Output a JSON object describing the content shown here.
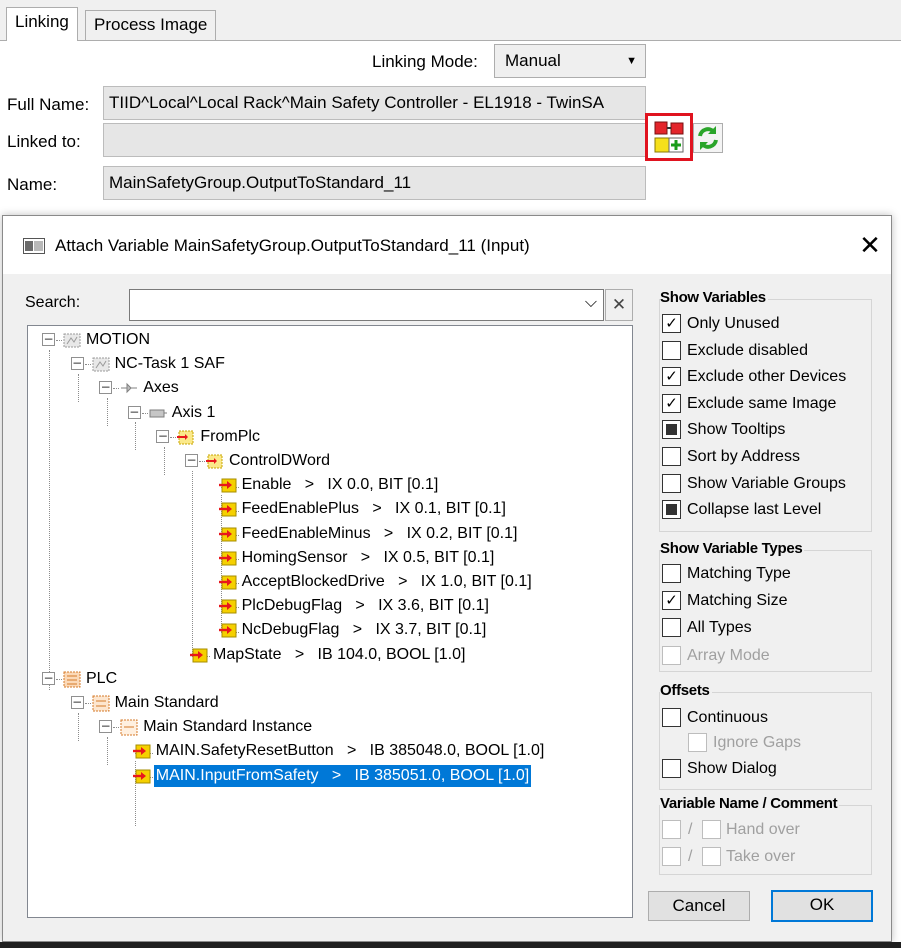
{
  "tabs": [
    {
      "label": "Linking",
      "active": true
    },
    {
      "label": "Process Image",
      "active": false
    }
  ],
  "properties": {
    "linking_mode_label": "Linking Mode:",
    "linking_mode_value": "Manual",
    "full_name_label": "Full Name:",
    "full_name_value": "TIID^Local^Local Rack^Main Safety Controller - EL1918 - TwinSA",
    "linked_to_label": "Linked to:",
    "linked_to_value": "",
    "name_label": "Name:",
    "name_value": "MainSafetyGroup.OutputToStandard_11"
  },
  "dialog": {
    "title": "Attach Variable MainSafetyGroup.OutputToStandard_11 (Input)",
    "close_glyph": "✕",
    "search_label": "Search:",
    "search_value": "",
    "search_clear_glyph": "✕",
    "tree": [
      {
        "label": "MOTION",
        "level": 0,
        "icon": "motion-icon",
        "expanded": true
      },
      {
        "label": "NC-Task 1 SAF",
        "level": 1,
        "icon": "nc-task-icon",
        "expanded": true
      },
      {
        "label": "Axes",
        "level": 2,
        "icon": "axes-icon",
        "expanded": true
      },
      {
        "label": "Axis 1",
        "level": 3,
        "icon": "axis-icon",
        "expanded": true
      },
      {
        "label": "FromPlc",
        "level": 4,
        "icon": "input-folder-icon",
        "expanded": true
      },
      {
        "label": "ControlDWord",
        "level": 5,
        "icon": "input-folder-icon",
        "expanded": true
      },
      {
        "label": "Enable   >   IX 0.0, BIT [0.1]",
        "level": 6,
        "icon": "input-variable-icon"
      },
      {
        "label": "FeedEnablePlus   >   IX 0.1, BIT [0.1]",
        "level": 6,
        "icon": "input-variable-icon"
      },
      {
        "label": "FeedEnableMinus   >   IX 0.2, BIT [0.1]",
        "level": 6,
        "icon": "input-variable-icon"
      },
      {
        "label": "HomingSensor   >   IX 0.5, BIT [0.1]",
        "level": 6,
        "icon": "input-variable-icon"
      },
      {
        "label": "AcceptBlockedDrive   >   IX 1.0, BIT [0.1]",
        "level": 6,
        "icon": "input-variable-icon"
      },
      {
        "label": "PlcDebugFlag   >   IX 3.6, BIT [0.1]",
        "level": 6,
        "icon": "input-variable-icon"
      },
      {
        "label": "NcDebugFlag   >   IX 3.7, BIT [0.1]",
        "level": 6,
        "icon": "input-variable-icon"
      },
      {
        "label": "MapState   >   IB 104.0, BOOL [1.0]",
        "level": 5,
        "icon": "input-variable-icon"
      },
      {
        "label": "PLC",
        "level": 0,
        "icon": "plc-icon",
        "expanded": true
      },
      {
        "label": "Main Standard",
        "level": 1,
        "icon": "plc-project-icon",
        "expanded": true
      },
      {
        "label": "Main Standard Instance",
        "level": 2,
        "icon": "plc-instance-icon",
        "expanded": true
      },
      {
        "label": "MAIN.SafetyResetButton   >   IB 385048.0, BOOL [1.0]",
        "level": 3,
        "icon": "input-variable-icon"
      },
      {
        "label": "MAIN.InputFromSafety   >   IB 385051.0, BOOL [1.0]",
        "level": 3,
        "icon": "input-variable-icon",
        "selected": true
      }
    ],
    "groups": {
      "show_variables": {
        "caption": "Show Variables",
        "options": [
          {
            "label": "Only Unused",
            "state": "checked"
          },
          {
            "label": "Exclude disabled",
            "state": "unchecked"
          },
          {
            "label": "Exclude other Devices",
            "state": "checked"
          },
          {
            "label": "Exclude same Image",
            "state": "checked"
          },
          {
            "label": "Show Tooltips",
            "state": "indeterminate"
          },
          {
            "label": "Sort by Address",
            "state": "unchecked"
          },
          {
            "label": "Show Variable Groups",
            "state": "unchecked"
          },
          {
            "label": "Collapse last Level",
            "state": "indeterminate"
          }
        ]
      },
      "show_variable_types": {
        "caption": "Show Variable Types",
        "options": [
          {
            "label": "Matching Type",
            "state": "unchecked"
          },
          {
            "label": "Matching Size",
            "state": "checked"
          },
          {
            "label": "All Types",
            "state": "unchecked"
          },
          {
            "label": "Array Mode",
            "state": "disabled"
          }
        ]
      },
      "offsets": {
        "caption": "Offsets",
        "continuous": "Continuous",
        "ignore_gaps": "Ignore Gaps",
        "show_dialog": "Show Dialog"
      },
      "variable_name": {
        "caption": "Variable Name / Comment",
        "separator": "/",
        "hand_over": "Hand over",
        "take_over": "Take over"
      }
    },
    "buttons": {
      "cancel": "Cancel",
      "ok": "OK"
    }
  },
  "colors": {
    "selection": "#0078d7",
    "highlight_frame": "#e0131f",
    "variable_icon": "#f5d000",
    "variable_arrow": "#e8171c"
  }
}
